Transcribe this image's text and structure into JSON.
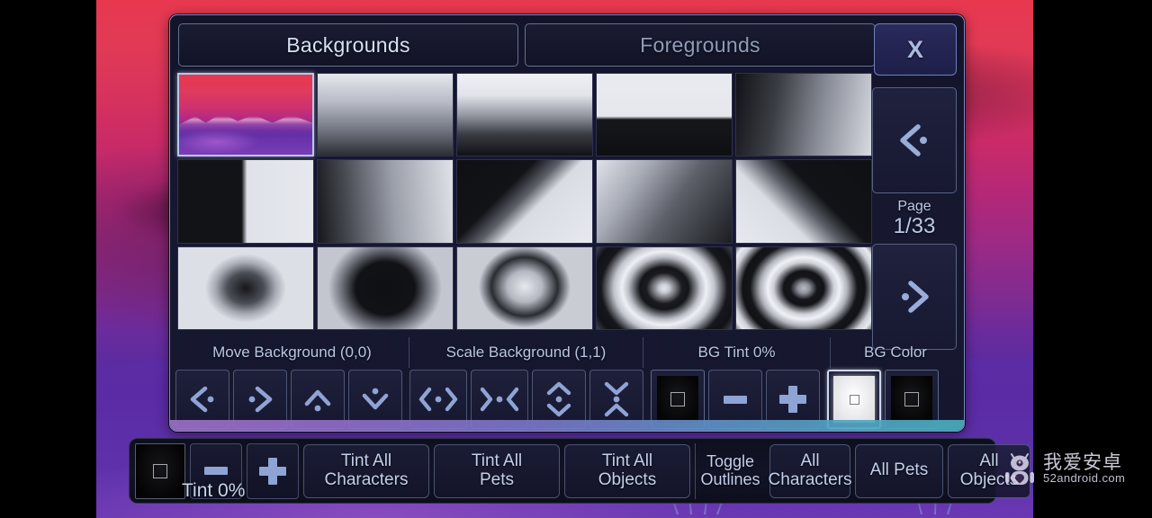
{
  "dialog": {
    "tabs": [
      {
        "label": "Backgrounds",
        "active": true
      },
      {
        "label": "Foregrounds",
        "active": false
      }
    ],
    "close_label": "X",
    "pagination": {
      "prev_icon": "chevron-left-dot-icon",
      "next_icon": "chevron-right-dot-icon",
      "page_word": "Page",
      "page_value": "1/33",
      "current_page": 1,
      "total_pages": 33
    },
    "thumbnails": [
      {
        "name": "landscape-sunset",
        "selected": true
      },
      {
        "name": "gradient-vertical-soft",
        "selected": false
      },
      {
        "name": "gradient-white-to-black",
        "selected": false
      },
      {
        "name": "split-horizontal-hard",
        "selected": false
      },
      {
        "name": "gradient-dark-to-light",
        "selected": false
      },
      {
        "name": "split-vertical-hard",
        "selected": false
      },
      {
        "name": "gradient-horizontal-light",
        "selected": false
      },
      {
        "name": "diagonal-black-white",
        "selected": false
      },
      {
        "name": "gradient-corner-light",
        "selected": false
      },
      {
        "name": "diagonal-white-black",
        "selected": false
      },
      {
        "name": "radial-dark-center",
        "selected": false
      },
      {
        "name": "radial-dark-blob",
        "selected": false
      },
      {
        "name": "radial-light-center",
        "selected": false
      },
      {
        "name": "concentric-rings-2",
        "selected": false
      },
      {
        "name": "concentric-rings-3",
        "selected": false
      }
    ],
    "controls": {
      "move_label": "Move Background (0,0)",
      "move_value": "(0,0)",
      "scale_label": "Scale Background (1,1)",
      "scale_value": "(1,1)",
      "tint_label": "BG Tint 0%",
      "tint_value": "0%",
      "color_label": "BG Color",
      "move_buttons": [
        "move-left-icon",
        "move-right-icon",
        "move-up-icon",
        "move-down-icon"
      ],
      "scale_buttons": [
        "expand-horizontal-icon",
        "shrink-horizontal-icon",
        "expand-vertical-icon",
        "shrink-vertical-icon"
      ],
      "tint_swatch": "black-swatch",
      "tint_minus": "minus-icon",
      "tint_plus": "plus-icon",
      "color_swatches": [
        {
          "name": "white-swatch",
          "color": "#ffffff",
          "active": true
        },
        {
          "name": "black-swatch",
          "color": "#0a0a0c",
          "active": false
        }
      ]
    }
  },
  "toolbar": {
    "tint_swatch": "black-swatch",
    "tint_minus": "minus-icon",
    "tint_plus": "plus-icon",
    "tint_label": "Tint 0%",
    "tint_value": "0%",
    "buttons": [
      {
        "label": "Tint All\nCharacters",
        "line1": "Tint All",
        "line2": "Characters"
      },
      {
        "label": "Tint All\nPets",
        "line1": "Tint All",
        "line2": "Pets"
      },
      {
        "label": "Tint All\nObjects",
        "line1": "Tint All",
        "line2": "Objects"
      }
    ],
    "toggle_outlines": {
      "line1": "Toggle",
      "line2": "Outlines"
    },
    "target_buttons": [
      {
        "line1": "All",
        "line2": "Characters"
      },
      {
        "line1": "All Pets",
        "line2": ""
      },
      {
        "line1": "All",
        "line2": "Objects"
      }
    ]
  },
  "watermark": {
    "title": "我爱安卓",
    "url": "52android.com",
    "icon": "android-robot-icon"
  },
  "colors": {
    "panel_bg": "#16172e",
    "panel_border": "#7b8bbd",
    "text_primary": "#c6d2ea",
    "text_muted": "#8f9cba",
    "accent_glyph": "#8fa3d4",
    "strip_start": "#9b6fc4",
    "strip_end": "#4aaebe",
    "sky_top": "#e8384f",
    "sky_bottom": "#6c34ad"
  }
}
